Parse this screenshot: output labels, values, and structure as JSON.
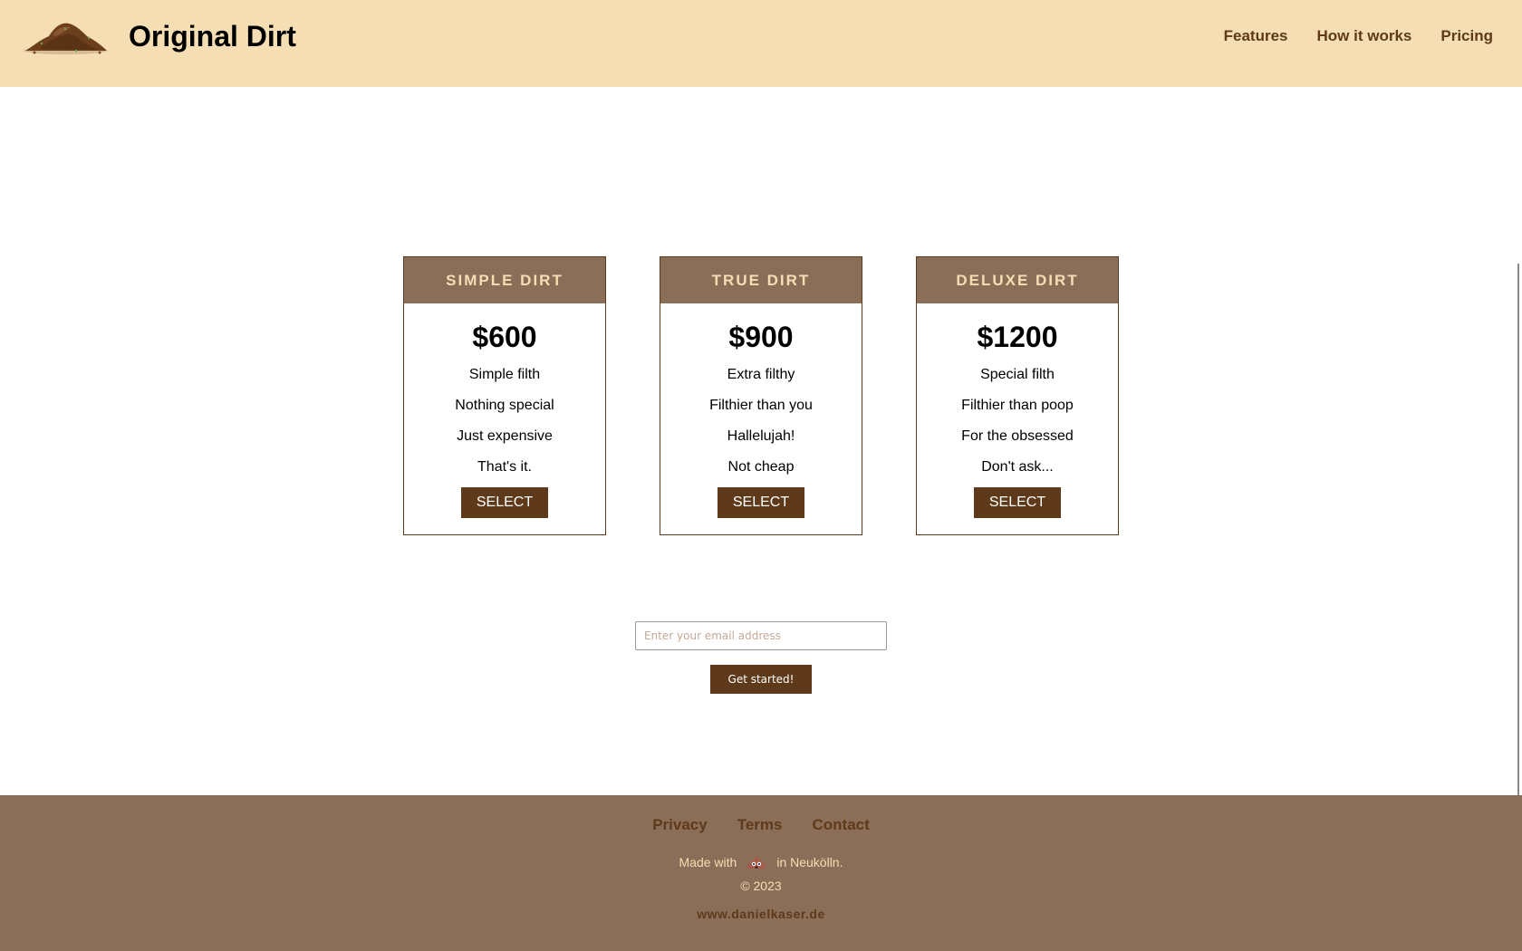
{
  "header": {
    "logo_icon": "dirt-pile-icon",
    "brand": "Original Dirt",
    "nav": [
      {
        "label": "Features"
      },
      {
        "label": "How it works"
      },
      {
        "label": "Pricing"
      }
    ]
  },
  "plans": [
    {
      "name": "SIMPLE DIRT",
      "price": "$600",
      "features": [
        "Simple filth",
        "Nothing special",
        "Just expensive",
        "That's it."
      ],
      "button": "SELECT"
    },
    {
      "name": "TRUE DIRT",
      "price": "$900",
      "features": [
        "Extra filthy",
        "Filthier than you",
        "Hallelujah!",
        "Not cheap"
      ],
      "button": "SELECT"
    },
    {
      "name": "DELUXE DIRT",
      "price": "$1200",
      "features": [
        "Special filth",
        "Filthier than poop",
        "For the obsessed",
        "Don't ask..."
      ],
      "button": "SELECT"
    }
  ],
  "signup": {
    "email_placeholder": "Enter your email address",
    "email_value": "",
    "button": "Get started!"
  },
  "footer": {
    "links": [
      {
        "label": "Privacy"
      },
      {
        "label": "Terms"
      },
      {
        "label": "Contact"
      }
    ],
    "made_with_prefix": "Made with",
    "made_with_icon": "poop-emoji-icon",
    "made_with_suffix": "in Neukölln.",
    "copyright": "© 2023",
    "website": "www.danielkaser.de"
  },
  "colors": {
    "header_bg": "#f5deb3",
    "accent_brown": "#5e3a1a",
    "card_header_bg": "#8b6e58",
    "card_header_text": "#f5deb3",
    "footer_bg": "#8b6e58"
  }
}
